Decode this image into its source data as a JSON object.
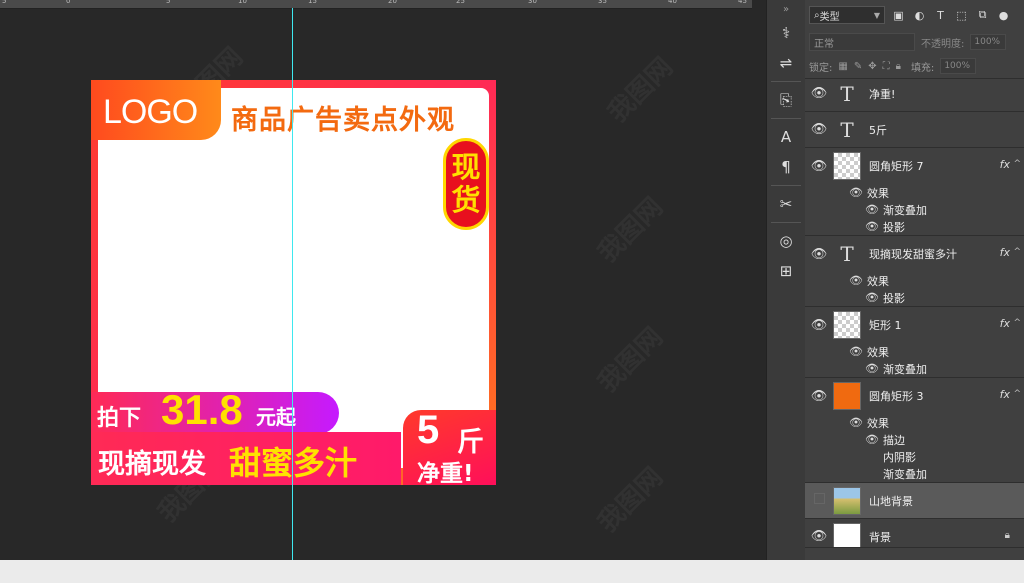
{
  "ruler": {
    "ticks": [
      "5",
      "0",
      "5",
      "10",
      "15",
      "20",
      "25",
      "30",
      "35",
      "40",
      "45"
    ]
  },
  "design": {
    "logo": "LOGO",
    "headline": "商品广告卖点外观",
    "stock_badge": [
      "现",
      "货"
    ],
    "price_prefix": "拍下",
    "price_value": "31.8",
    "price_suffix": "元起",
    "slogan_white": "现摘现发",
    "slogan_yellow": "甜蜜多汁",
    "weight_num": "5",
    "weight_unit": "斤",
    "weight_label": "净重!"
  },
  "layers_panel": {
    "kind_filter": "类型",
    "blend_mode": "正常",
    "opacity_label": "不透明度:",
    "opacity_value": "100%",
    "lock_label": "锁定:",
    "fill_label": "填充:",
    "fill_value": "100%",
    "layers": [
      {
        "name": "净重!",
        "type": "text"
      },
      {
        "name": "5斤",
        "type": "text"
      },
      {
        "name": "圆角矩形 7",
        "type": "shape",
        "effects_label": "效果",
        "effects": [
          "渐变叠加",
          "投影"
        ]
      },
      {
        "name": "现摘现发甜蜜多汁",
        "type": "text",
        "effects_label": "效果",
        "effects": [
          "投影"
        ]
      },
      {
        "name": "矩形 1",
        "type": "shape",
        "effects_label": "效果",
        "effects": [
          "渐变叠加"
        ]
      },
      {
        "name": "圆角矩形 3",
        "type": "shape",
        "effects_label": "效果",
        "effects": [
          "描边",
          "内阴影",
          "渐变叠加"
        ]
      },
      {
        "name": "山地背景",
        "type": "image",
        "selected": true
      },
      {
        "name": "背景",
        "type": "background"
      }
    ],
    "fx": "fx"
  },
  "watermark": "我图网",
  "colors": {
    "guide": "#3ee8ef",
    "price_yellow": "#ffe100",
    "headline_orange": "#f36a10"
  }
}
